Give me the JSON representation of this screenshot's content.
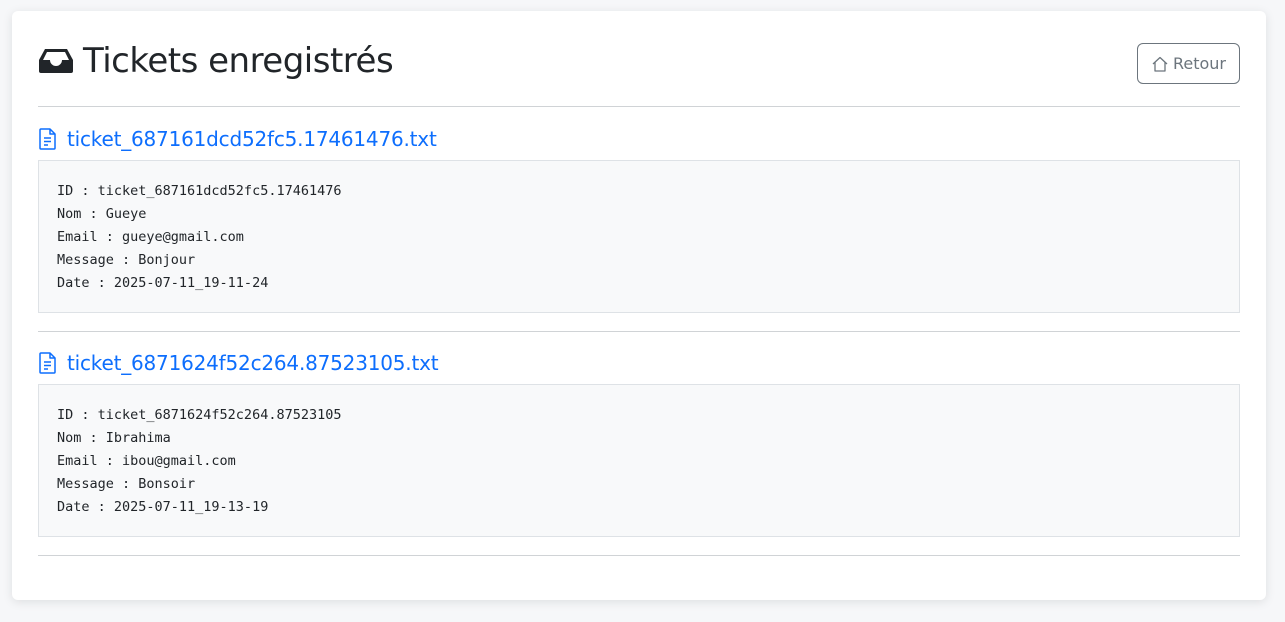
{
  "header": {
    "title": "Tickets enregistrés",
    "back_label": "Retour",
    "icon": "inbox-icon"
  },
  "tickets": [
    {
      "filename": "ticket_687161dcd52fc5.17461476.txt",
      "icon": "file-text-icon",
      "lines": [
        "ID : ticket_687161dcd52fc5.17461476",
        "Nom : Gueye",
        "Email : gueye@gmail.com",
        "Message : Bonjour",
        "Date : 2025-07-11_19-11-24"
      ]
    },
    {
      "filename": "ticket_6871624f52c264.87523105.txt",
      "icon": "file-text-icon",
      "lines": [
        "ID : ticket_6871624f52c264.87523105",
        "Nom : Ibrahima",
        "Email : ibou@gmail.com",
        "Message : Bonsoir",
        "Date : 2025-07-11_19-13-19"
      ]
    }
  ],
  "colors": {
    "link": "#0d6efd",
    "background": "#f6f7f9",
    "panel": "#f8f9fa",
    "secondary": "#6c757d"
  }
}
